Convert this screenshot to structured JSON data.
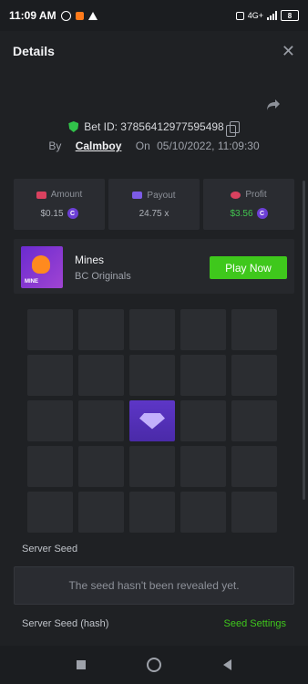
{
  "statusbar": {
    "time": "11:09 AM",
    "network": "4G+",
    "battery": "8"
  },
  "header": {
    "title": "Details",
    "close_icon": "close-icon"
  },
  "bet": {
    "bet_id_label": "Bet ID: 378564129775954​98",
    "by_label": "By",
    "user": "Calmboy",
    "on_label": "On",
    "datetime": "05/10/2022, 11:09:30"
  },
  "stats": {
    "amount": {
      "label": "Amount",
      "value": "$0.15"
    },
    "payout": {
      "label": "Payout",
      "value": "24.75 x"
    },
    "profit": {
      "label": "Profit",
      "value": "$3.56",
      "color": "#42c64f"
    }
  },
  "game": {
    "name": "Mines",
    "provider": "BC Originals",
    "play_label": "Play Now"
  },
  "mines_grid": {
    "rows": 5,
    "cols": 5,
    "revealed": [
      {
        "row": 3,
        "col": 3,
        "item": "gem"
      }
    ]
  },
  "server_seed": {
    "label": "Server Seed",
    "text": "The seed hasn't been revealed yet."
  },
  "server_seed_hash": {
    "label": "Server Seed (hash)",
    "settings_label": "Seed Settings"
  },
  "colors": {
    "accent_green": "#3fc81c",
    "background": "#1f2124",
    "gem_tile": "#5d36c7"
  }
}
